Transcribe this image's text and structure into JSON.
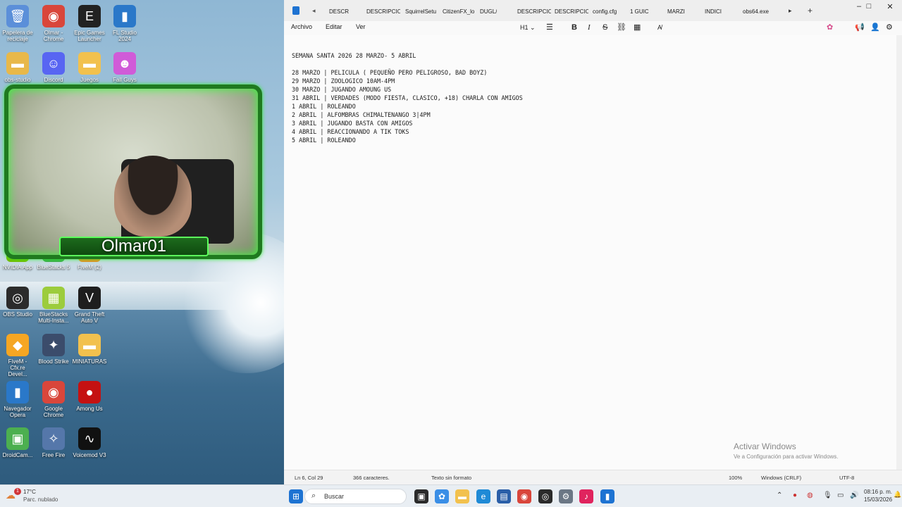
{
  "desktop": {
    "icons": [
      {
        "label": "Papelera de reciclaje",
        "icon": "recycle-bin-icon",
        "color": "#5b8fd9",
        "glyph": "🗑"
      },
      {
        "label": "Olmar - Chrome",
        "icon": "chrome-icon",
        "color": "#d9463b",
        "glyph": "◉"
      },
      {
        "label": "Epic Games Launcher",
        "icon": "epic-games-icon",
        "color": "#222222",
        "glyph": "E"
      },
      {
        "label": "FL Studio 2024",
        "icon": "fl-studio-icon",
        "color": "#2a78c9",
        "glyph": "▮"
      },
      {
        "label": "obs-studio",
        "icon": "folder-icon",
        "color": "#e8b84a",
        "glyph": "▬"
      },
      {
        "label": "Discord",
        "icon": "discord-icon",
        "color": "#5865f2",
        "glyph": "☺"
      },
      {
        "label": "Juegos",
        "icon": "folder-icon",
        "color": "#f2c14e",
        "glyph": "▬"
      },
      {
        "label": "Fall Guys",
        "icon": "fall-guys-icon",
        "color": "#d05bd8",
        "glyph": "☻"
      },
      {
        "label": "NVIDIA App",
        "icon": "nvidia-icon",
        "color": "#76b900",
        "glyph": "◣"
      },
      {
        "label": "BlueStacks 5",
        "icon": "bluestacks-icon",
        "color": "#3da84b",
        "glyph": "▦"
      },
      {
        "label": "FiveM (2)",
        "icon": "fivem-icon",
        "color": "#f08a24",
        "glyph": "◆"
      },
      {
        "label": "OBS Studio",
        "icon": "obs-icon",
        "color": "#2b2b2b",
        "glyph": "◎"
      },
      {
        "label": "BlueStacks Multi-Insta...",
        "icon": "bluestacks-multi-icon",
        "color": "#9ccc3c",
        "glyph": "▦"
      },
      {
        "label": "Grand Theft Auto V",
        "icon": "gta-v-icon",
        "color": "#1e1e1e",
        "glyph": "V"
      },
      {
        "label": "FiveM - Cfx.re Devel...",
        "icon": "fivem-icon",
        "color": "#f5a623",
        "glyph": "◆"
      },
      {
        "label": "Blood Strike",
        "icon": "blood-strike-icon",
        "color": "#3b4c6b",
        "glyph": "✦"
      },
      {
        "label": "MINIATURAS",
        "icon": "folder-icon",
        "color": "#f2c14e",
        "glyph": "▬"
      },
      {
        "label": "Navegador Opera",
        "icon": "opera-icon",
        "color": "#2a78c9",
        "glyph": "▮"
      },
      {
        "label": "Google Chrome",
        "icon": "chrome-icon",
        "color": "#d9463b",
        "glyph": "◉"
      },
      {
        "label": "Among Us",
        "icon": "among-us-icon",
        "color": "#c51111",
        "glyph": "●"
      },
      {
        "label": "DroidCam...",
        "icon": "droidcam-icon",
        "color": "#4caf50",
        "glyph": "▣"
      },
      {
        "label": "Free Fire",
        "icon": "free-fire-icon",
        "color": "#5577aa",
        "glyph": "✧"
      },
      {
        "label": "Voicemod V3",
        "icon": "voicemod-icon",
        "color": "#111111",
        "glyph": "∿"
      }
    ],
    "webcam_name": "Olmar01"
  },
  "notepad": {
    "tabs": [
      "DESCR",
      "DESCRIPCIO",
      "SquirrelSetu",
      "CitizenFX_lo",
      "DUGL/",
      "DESCRIPCIO",
      "DESCRIPCIO",
      "config.cfg",
      "1 GUIC",
      "MARZI",
      "INDICI",
      "obs64.exe"
    ],
    "menus": {
      "file": "Archivo",
      "edit": "Editar",
      "view": "Ver"
    },
    "heading_selector": "H1",
    "lines": [
      "SEMANA SANTA 2026 28 MARZO- 5 ABRIL",
      "",
      "28 MARZO | PELICULA ( PEQUEÑO PERO PELIGROSO, BAD BOYZ)",
      "29 MARZO | ZOOLOGICO 10AM-4PM",
      "30 MARZO | JUGANDO AMOUNG US",
      "31 ABRIL | VERDADES (MODO FIESTA, CLASICO, +18) CHARLA CON AMIGOS",
      "1 ABRIL | ROLEANDO",
      "2 ABRIL | ALFOMBRAS CHIMALTENANGO 3|4PM",
      "3 ABRIL | JUGANDO BASTA CON AMIGOS",
      "4 ABRIL | REACCIONANDO A TIK TOKS",
      "5 ABRIL | ROLEANDO"
    ],
    "status": {
      "position": "Ln 6, Col 29",
      "chars": "366 caracteres.",
      "format": "Texto sin formato",
      "zoom": "100%",
      "line_ending": "Windows (CRLF)",
      "encoding": "UTF-8"
    },
    "watermark": {
      "title": "Activar Windows",
      "subtitle": "Ve a Configuración para activar Windows."
    }
  },
  "taskbar": {
    "weather_temp": "17°C",
    "weather_desc": "Parc. nublado",
    "weather_badge": "1",
    "search_placeholder": "Buscar",
    "time": "08:16 p. m.",
    "date": "15/03/2026"
  }
}
